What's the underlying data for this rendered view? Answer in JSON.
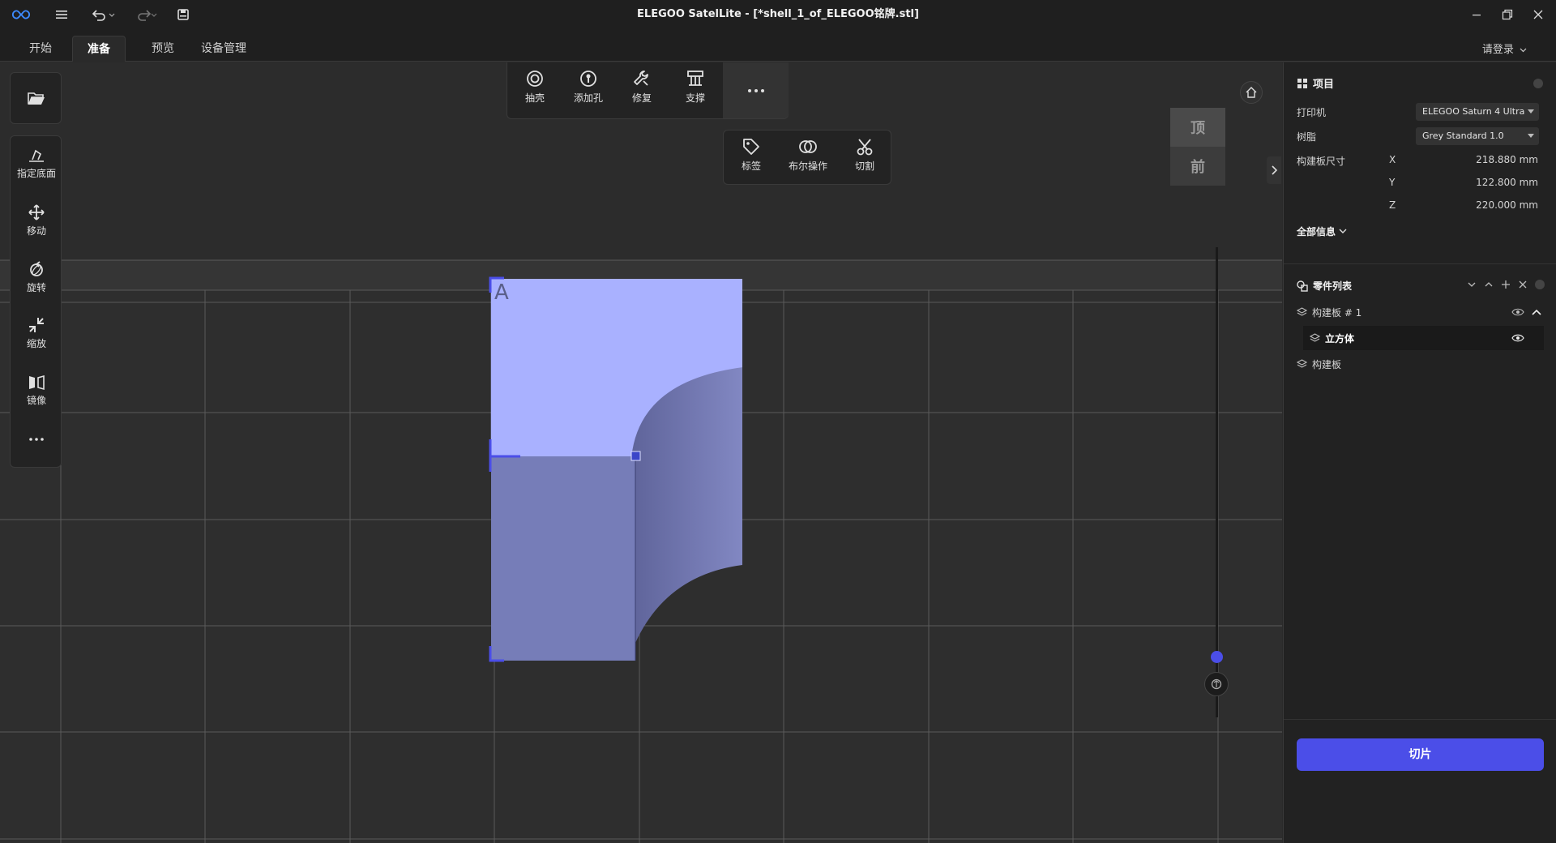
{
  "window": {
    "title": "ELEGOO SatelLite - [*shell_1_of_ELEGOO铭牌.stl]"
  },
  "menu": {
    "tabs": [
      "开始",
      "准备",
      "预览",
      "设备管理"
    ],
    "active_tab": "准备",
    "login": "请登录"
  },
  "left_toolbar": {
    "items": [
      {
        "label": "指定底面",
        "icon": "place-face-icon"
      },
      {
        "label": "移动",
        "icon": "move-icon"
      },
      {
        "label": "旋转",
        "icon": "rotate-icon"
      },
      {
        "label": "缩放",
        "icon": "scale-icon"
      },
      {
        "label": "镜像",
        "icon": "mirror-icon"
      }
    ]
  },
  "top_toolbar": {
    "items": [
      {
        "label": "抽壳",
        "icon": "shell-icon"
      },
      {
        "label": "添加孔",
        "icon": "add-hole-icon"
      },
      {
        "label": "修复",
        "icon": "repair-icon"
      },
      {
        "label": "支撑",
        "icon": "support-icon"
      }
    ],
    "more_items": [
      {
        "label": "标签",
        "icon": "tag-icon"
      },
      {
        "label": "布尔操作",
        "icon": "boolean-icon"
      },
      {
        "label": "切割",
        "icon": "cut-icon"
      }
    ]
  },
  "view_cube": {
    "top": "顶",
    "front": "前"
  },
  "project_panel": {
    "title": "项目",
    "printer_label": "打印机",
    "printer_value": "ELEGOO Saturn 4 Ultra",
    "resin_label": "树脂",
    "resin_value": "Grey Standard 1.0",
    "plate_label": "构建板尺寸",
    "axes": [
      {
        "axis": "X",
        "value": "218.880 mm"
      },
      {
        "axis": "Y",
        "value": "122.800 mm"
      },
      {
        "axis": "Z",
        "value": "220.000 mm"
      }
    ],
    "all_info": "全部信息"
  },
  "parts_panel": {
    "title": "零件列表",
    "rows": [
      {
        "label": "构建板 # 1"
      },
      {
        "label": "立方体"
      },
      {
        "label": "构建板"
      }
    ]
  },
  "slice_button": "切片",
  "colors": {
    "accent": "#4b4ee8",
    "model_top": "#a8b0ff",
    "model_side": "#7a80b8"
  }
}
